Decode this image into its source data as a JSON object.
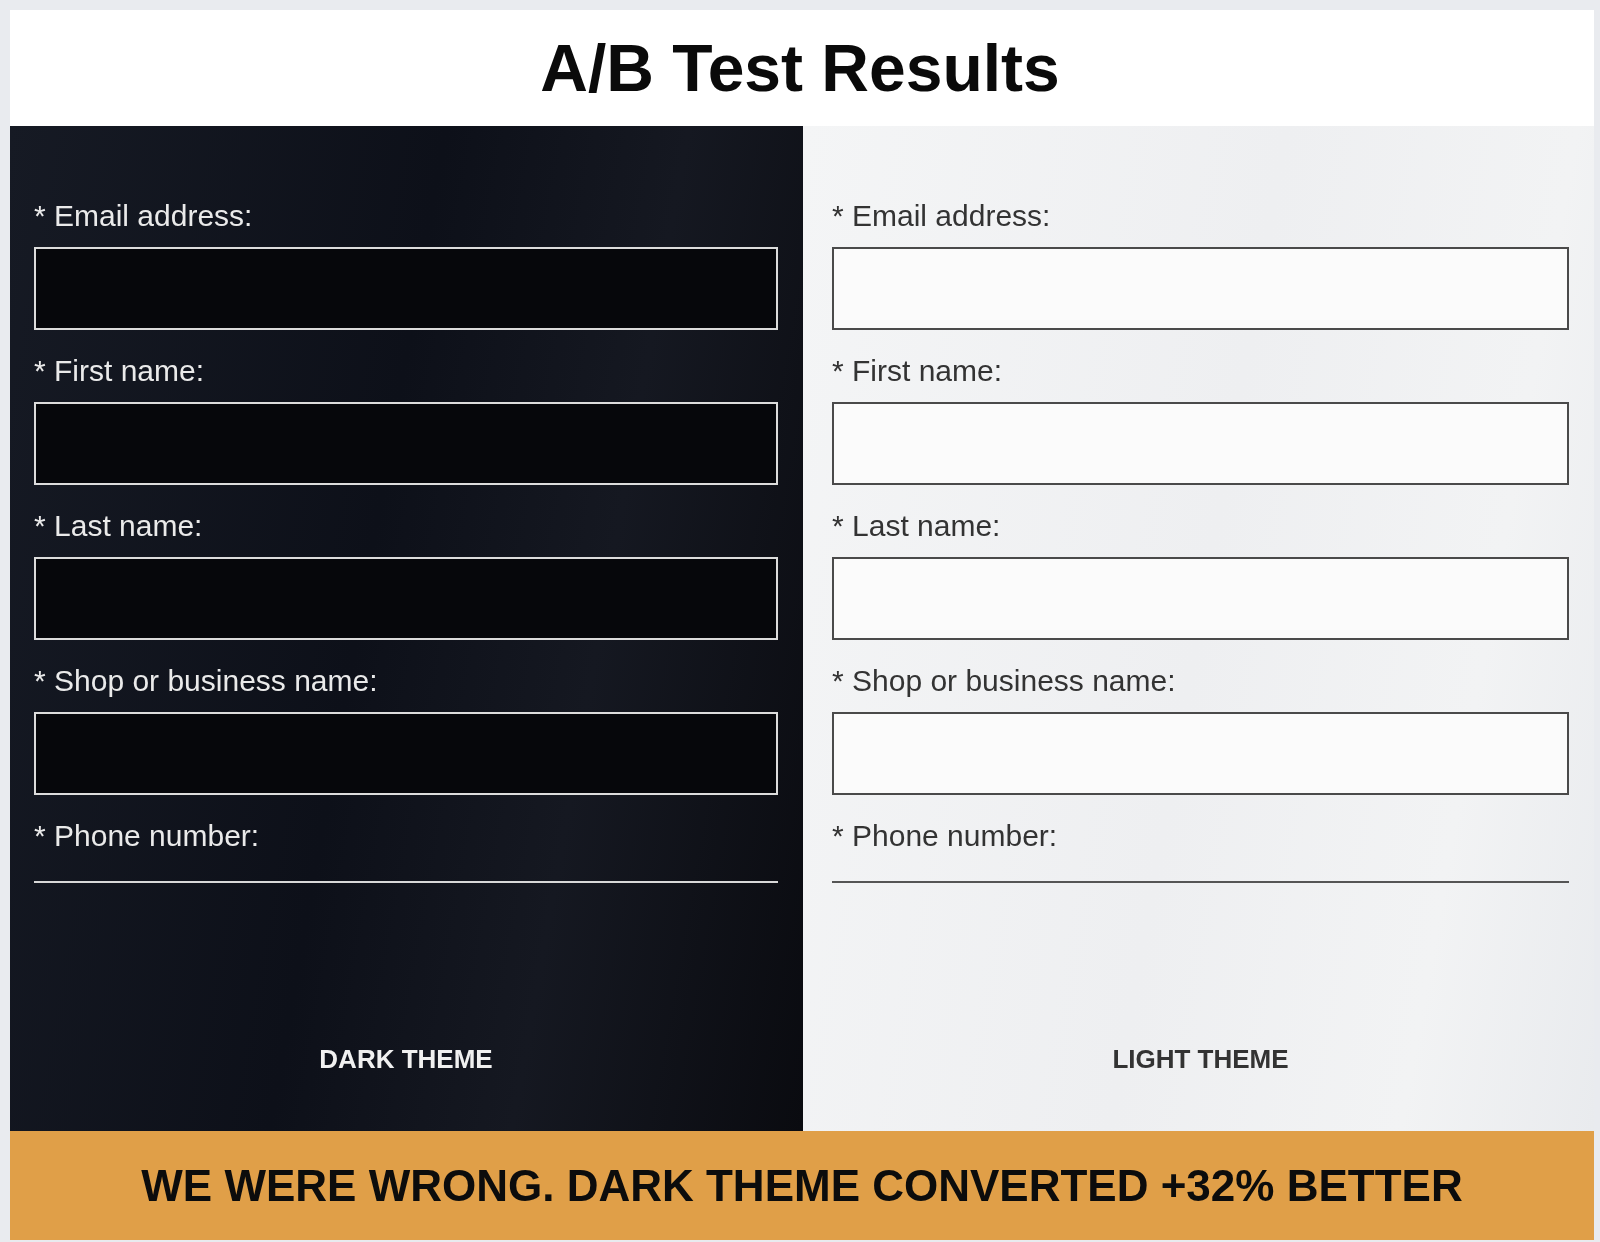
{
  "title": "A/B Test Results",
  "variants": [
    {
      "kind": "dark",
      "fields": [
        {
          "label": "* Email address:",
          "kind": "box"
        },
        {
          "label": "* First name:",
          "kind": "box"
        },
        {
          "label": "* Last name:",
          "kind": "box"
        },
        {
          "label": "* Shop or business name:",
          "kind": "box"
        },
        {
          "label": "* Phone number:",
          "kind": "line"
        }
      ],
      "caption": "DARK THEME"
    },
    {
      "kind": "light",
      "fields": [
        {
          "label": "* Email address:",
          "kind": "box"
        },
        {
          "label": "* First name:",
          "kind": "box"
        },
        {
          "label": "* Last name:",
          "kind": "box"
        },
        {
          "label": "* Shop or business name:",
          "kind": "box"
        },
        {
          "label": "* Phone number:",
          "kind": "line"
        }
      ],
      "caption": "LIGHT THEME"
    }
  ],
  "banner": "WE WERE WRONG. DARK THEME CONVERTED +32% BETTER"
}
